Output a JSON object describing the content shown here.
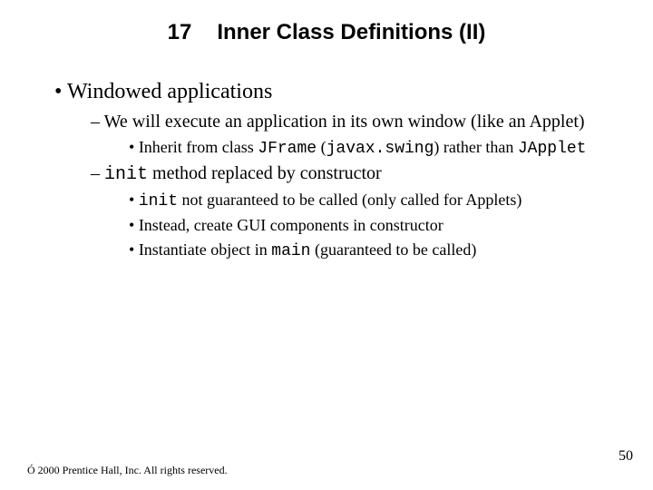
{
  "title": {
    "number": "17",
    "text": "Inner Class Definitions (II)"
  },
  "bullets": {
    "b1": "Windowed applications",
    "b1_1_a": "We will execute an application in its own window (like an Applet)",
    "b1_1_1_pre": "Inherit from class ",
    "b1_1_1_code1": "JFrame",
    "b1_1_1_mid": " (",
    "b1_1_1_code2": "javax.swing",
    "b1_1_1_post": ") rather than ",
    "b1_1_1_code3": "JApplet",
    "b1_2_code": "init",
    "b1_2_rest": " method replaced by constructor",
    "b1_2_1_code": "init",
    "b1_2_1_rest": " not guaranteed to be called (only called for Applets)",
    "b1_2_2": "Instead, create GUI components in constructor",
    "b1_2_3_pre": "Instantiate object in ",
    "b1_2_3_code": "main",
    "b1_2_3_post": " (guaranteed to be called)"
  },
  "footer": "Ó 2000 Prentice Hall, Inc. All rights reserved.",
  "page": "50"
}
